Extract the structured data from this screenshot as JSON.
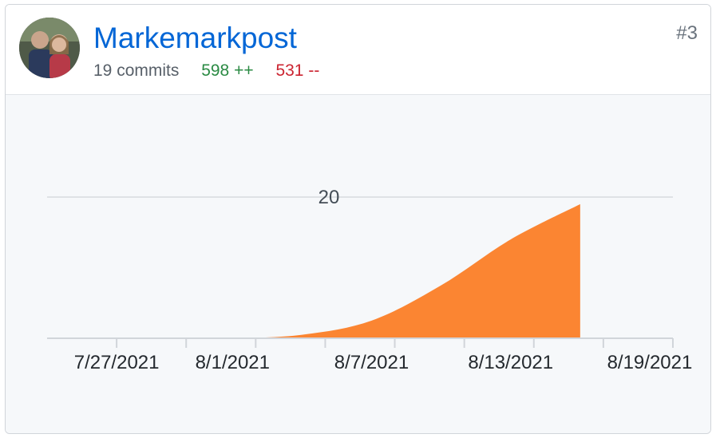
{
  "contributor": {
    "name": "Markemarkpost",
    "commits_text": "19 commits",
    "additions_text": "598 ++",
    "deletions_text": "531 --",
    "rank": "#3"
  },
  "colors": {
    "link": "#0366d6",
    "additions": "#2a8a43",
    "deletions": "#cb2431",
    "area_fill": "#fb8532"
  },
  "chart_data": {
    "type": "area",
    "x": [
      "2021-07-24",
      "2021-07-27",
      "2021-07-30",
      "2021-08-01",
      "2021-08-04",
      "2021-08-07",
      "2021-08-10",
      "2021-08-13",
      "2021-08-16"
    ],
    "values": [
      0,
      0,
      0,
      0,
      0.5,
      2.5,
      7.5,
      14,
      19
    ],
    "xlim": [
      "2021-07-24",
      "2021-08-20"
    ],
    "ylim": [
      0,
      20
    ],
    "y_ticks": [
      20
    ],
    "x_tick_labels": [
      "7/27/2021",
      "8/1/2021",
      "8/7/2021",
      "8/13/2021",
      "8/19/2021"
    ],
    "grid": true
  }
}
